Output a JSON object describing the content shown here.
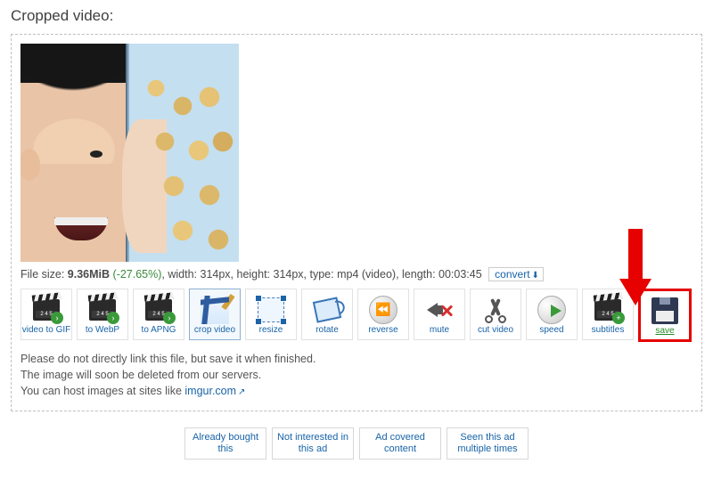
{
  "section_title": "Cropped video:",
  "info": {
    "prefix": "File size: ",
    "size": "9.36MiB",
    "pct": "(-27.65%)",
    "mid": ", width: 314px, height: 314px, type: mp4 (video), length: 00:03:45",
    "convert_label": "convert"
  },
  "tools": {
    "to_gif": "video to GIF",
    "to_webp": "to WebP",
    "to_apng": "to APNG",
    "crop": "crop video",
    "resize": "resize",
    "rotate": "rotate",
    "reverse": "reverse",
    "mute": "mute",
    "cut": "cut video",
    "speed": "speed",
    "subtitles": "subtitles",
    "save": "save"
  },
  "clapper_tag": "2 4 5",
  "notes": {
    "line1": "Please do not directly link this file, but save it when finished.",
    "line2": "The image will soon be deleted from our servers.",
    "line3_pre": "You can host images at sites like ",
    "line3_link": "imgur.com"
  },
  "ads": {
    "b1": "Already bought this",
    "b2": "Not interested in this ad",
    "b3": "Ad covered content",
    "b4": "Seen this ad multiple times"
  }
}
